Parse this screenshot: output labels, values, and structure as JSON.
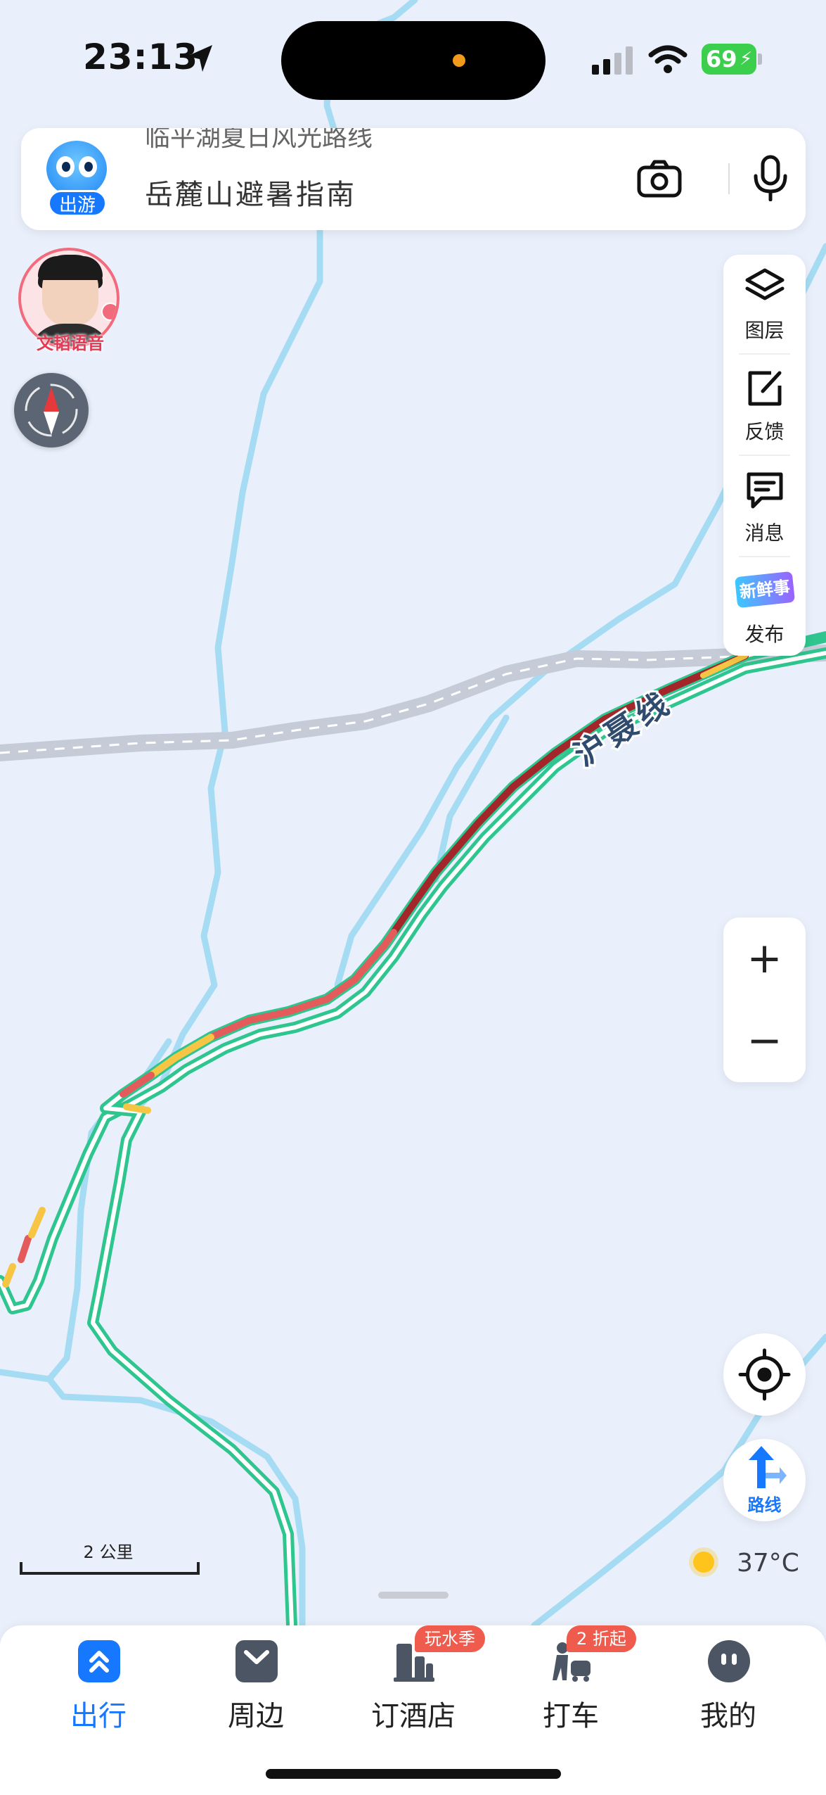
{
  "colors": {
    "map_background": "#eaf0fb",
    "river": "#a6dcf3",
    "rail": "#c8cfdb",
    "traffic_smooth": "#2fc58f",
    "traffic_slow": "#f5c543",
    "traffic_congested": "#e45b5b",
    "traffic_severe": "#a3272a",
    "accent": "#1677ff"
  },
  "status_bar": {
    "time": "23:13",
    "battery": "69"
  },
  "search": {
    "clipped_text": "临平湖夏日风光路线",
    "text": "岳麓山避暑指南",
    "mascot_badge": "出游"
  },
  "voice_pack": {
    "label": "文韬语音"
  },
  "road_label": "沪聂线",
  "tools": [
    {
      "label": "图层",
      "icon": "layers-icon"
    },
    {
      "label": "反馈",
      "icon": "feedback-icon"
    },
    {
      "label": "消息",
      "icon": "message-icon"
    },
    {
      "label": "发布",
      "icon": "new-story-icon",
      "art_text": "新鲜事"
    }
  ],
  "zoom": {
    "in": "+",
    "out": "−"
  },
  "route_label": "路线",
  "weather": {
    "temperature": "37°C",
    "icon": "sun-icon"
  },
  "scale_label": "2 公里",
  "tabs": [
    {
      "label": "出行",
      "icon": "travel-icon",
      "active": true
    },
    {
      "label": "周边",
      "icon": "nearby-icon"
    },
    {
      "label": "订酒店",
      "icon": "hotel-icon",
      "badge": "玩水季"
    },
    {
      "label": "打车",
      "icon": "taxi-icon",
      "badge": "2 折起"
    },
    {
      "label": "我的",
      "icon": "profile-icon"
    }
  ]
}
